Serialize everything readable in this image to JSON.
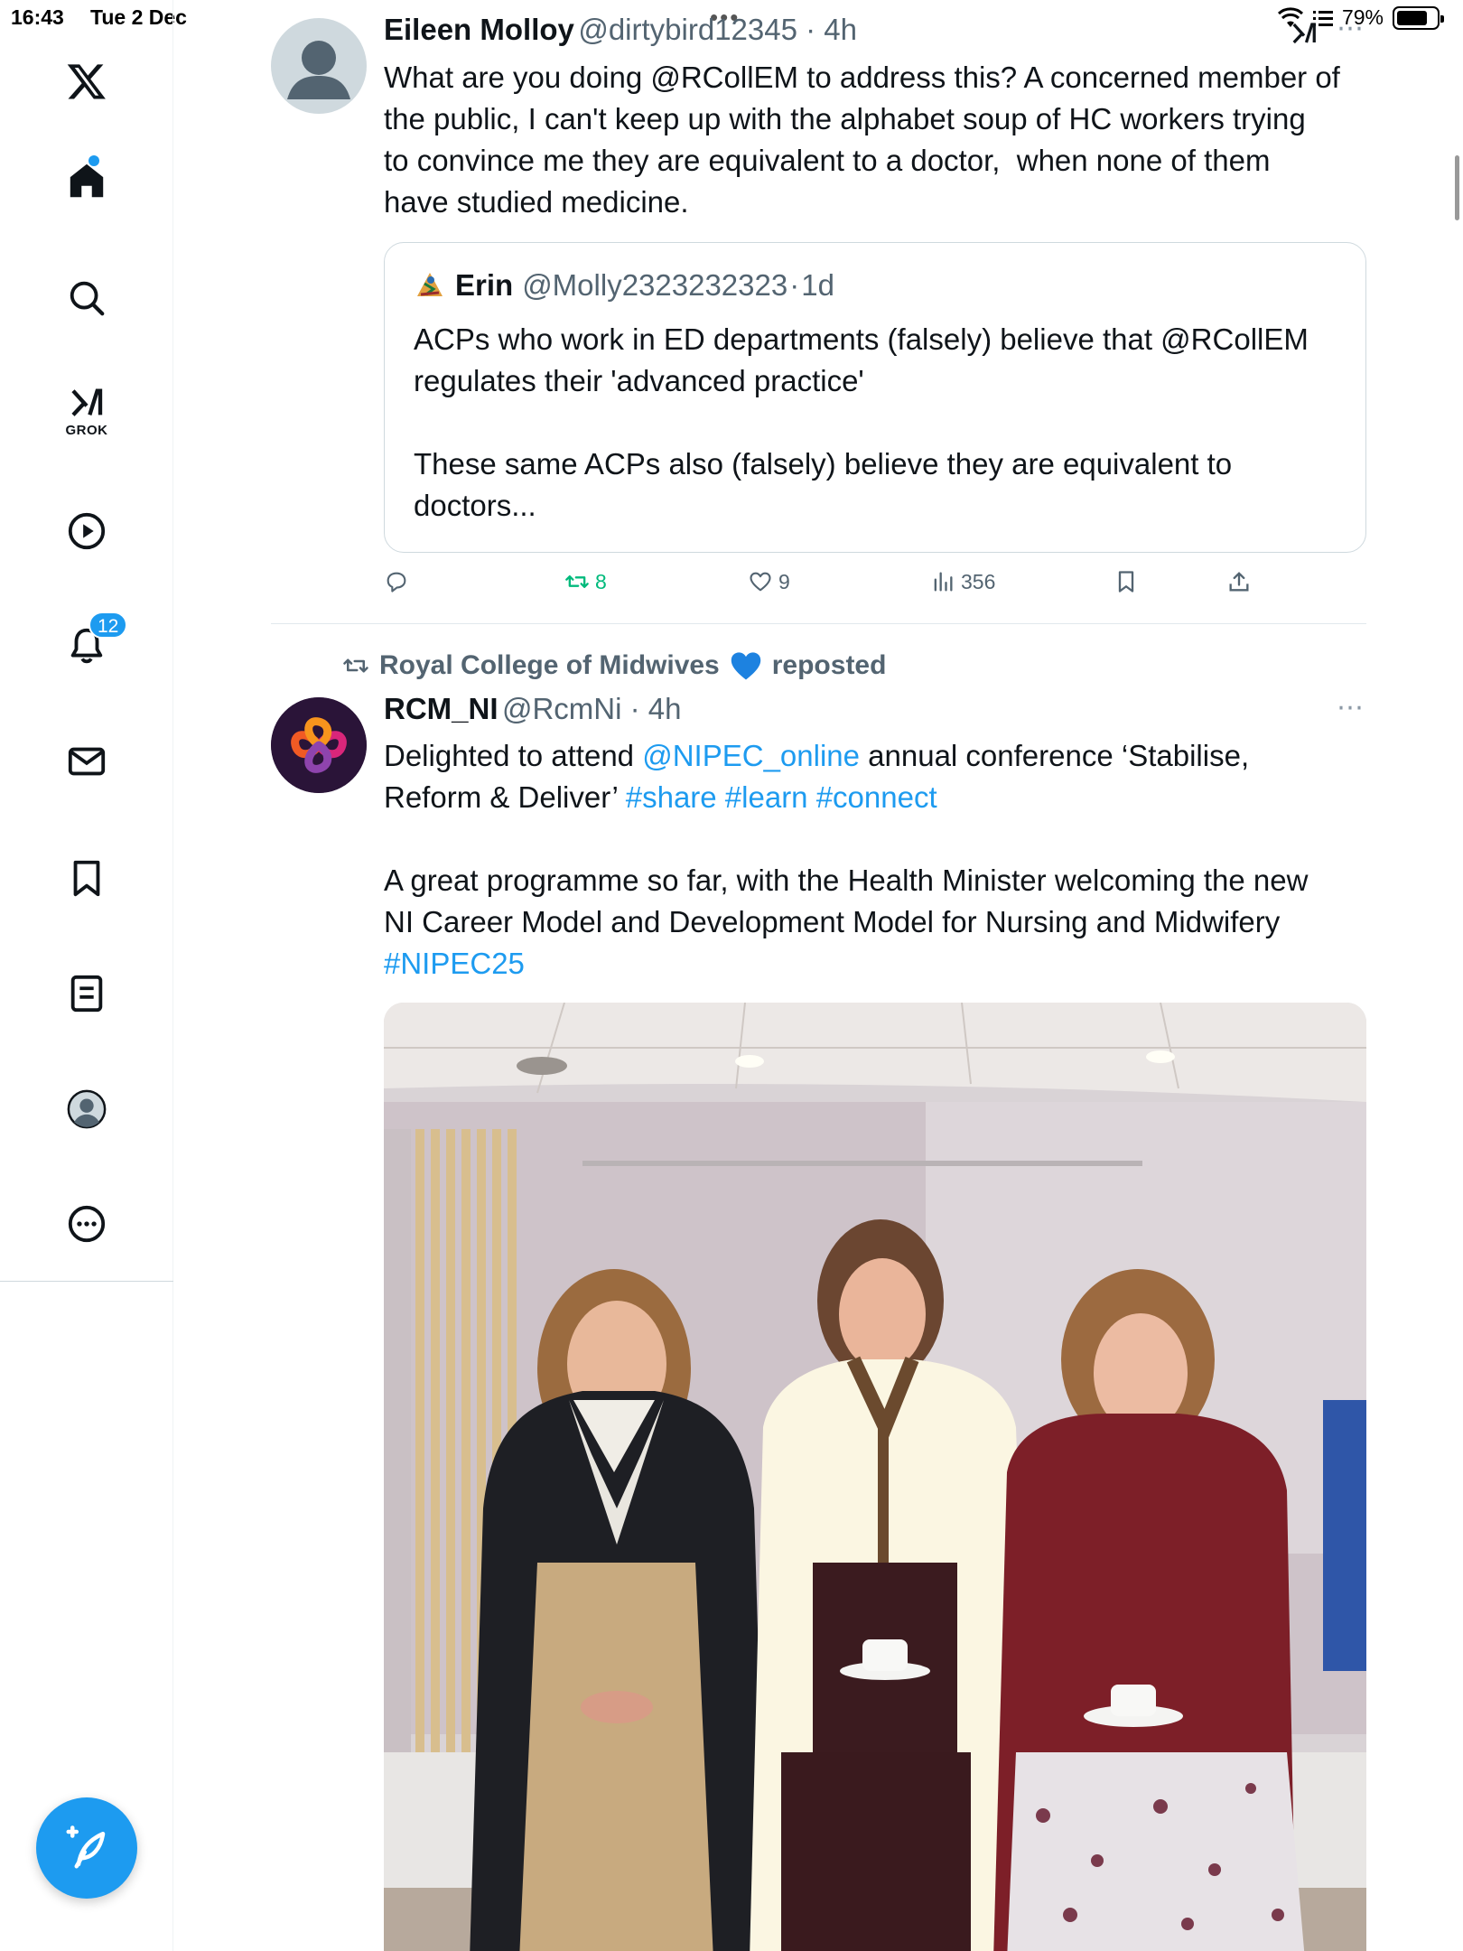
{
  "status_bar": {
    "time": "16:43",
    "date": "Tue 2 Dec",
    "battery": "79%",
    "battery_level": 0.79
  },
  "sidebar": {
    "grok_label": "GROK",
    "notifications_count": "12"
  },
  "tweet1": {
    "name": "Eileen Molloy",
    "handle": "@dirtybird12345",
    "time": "4h",
    "text": "What are you doing @RCollEM to address this? A concerned member of\nthe public, I can't keep up with the alphabet soup of HC workers trying\nto convince me they are equivalent to a doctor,  when none of them\nhave studied medicine.",
    "quote": {
      "name": "Erin",
      "handle": "@Molly2323232323",
      "time": "1d",
      "text": "ACPs who work in ED departments (falsely) believe that @RCollEM\nregulates their 'advanced practice'\n\nThese same ACPs also (falsely) believe they are equivalent to\ndoctors..."
    },
    "reposts": "8",
    "likes": "9",
    "views": "356"
  },
  "tweet2": {
    "reposted_by": "Royal College of Midwives",
    "reposted_suffix": "reposted",
    "name": "RCM_NI",
    "handle": "@RcmNi",
    "time": "4h",
    "line1_a": "Delighted to attend ",
    "line1_mention": "@NIPEC_online",
    "line1_b": " annual conference ‘Stabilise,",
    "line2_a": "Reform & Deliver’ ",
    "line2_tags": "#share #learn #connect",
    "para2": "A great programme so far, with the Health Minister welcoming the new\nNI Career Model and Development Model for Nursing and Midwifery",
    "tag_nipec": "#NIPEC25"
  },
  "colors": {
    "accent": "#1d9bf0",
    "text": "#0f1419",
    "secondary": "#536471",
    "repost_green": "#00ba7c"
  }
}
